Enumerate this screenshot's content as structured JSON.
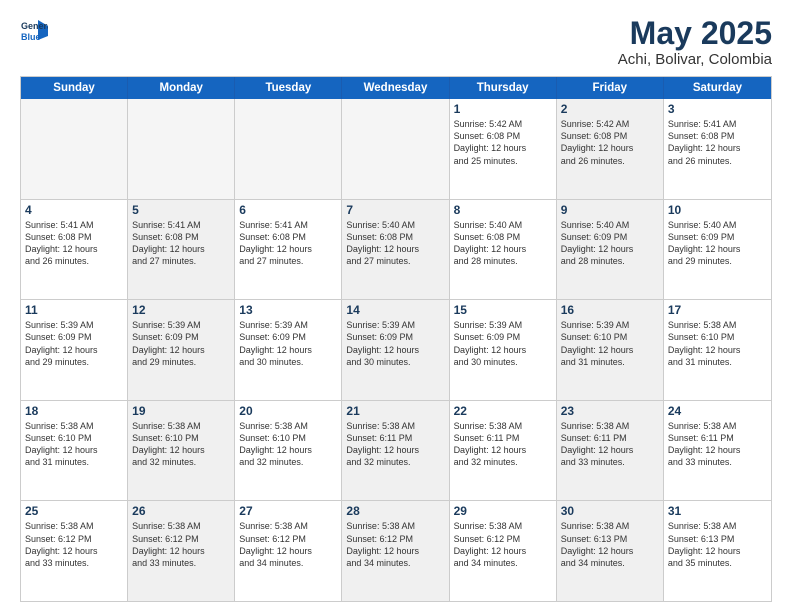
{
  "logo": {
    "line1": "General",
    "line2": "Blue"
  },
  "title": "May 2025",
  "subtitle": "Achi, Bolivar, Colombia",
  "header_days": [
    "Sunday",
    "Monday",
    "Tuesday",
    "Wednesday",
    "Thursday",
    "Friday",
    "Saturday"
  ],
  "weeks": [
    [
      {
        "day": "",
        "info": "",
        "shaded": true
      },
      {
        "day": "",
        "info": "",
        "shaded": true
      },
      {
        "day": "",
        "info": "",
        "shaded": true
      },
      {
        "day": "",
        "info": "",
        "shaded": true
      },
      {
        "day": "1",
        "info": "Sunrise: 5:42 AM\nSunset: 6:08 PM\nDaylight: 12 hours\nand 25 minutes.",
        "shaded": false
      },
      {
        "day": "2",
        "info": "Sunrise: 5:42 AM\nSunset: 6:08 PM\nDaylight: 12 hours\nand 26 minutes.",
        "shaded": true
      },
      {
        "day": "3",
        "info": "Sunrise: 5:41 AM\nSunset: 6:08 PM\nDaylight: 12 hours\nand 26 minutes.",
        "shaded": false
      }
    ],
    [
      {
        "day": "4",
        "info": "Sunrise: 5:41 AM\nSunset: 6:08 PM\nDaylight: 12 hours\nand 26 minutes.",
        "shaded": false
      },
      {
        "day": "5",
        "info": "Sunrise: 5:41 AM\nSunset: 6:08 PM\nDaylight: 12 hours\nand 27 minutes.",
        "shaded": true
      },
      {
        "day": "6",
        "info": "Sunrise: 5:41 AM\nSunset: 6:08 PM\nDaylight: 12 hours\nand 27 minutes.",
        "shaded": false
      },
      {
        "day": "7",
        "info": "Sunrise: 5:40 AM\nSunset: 6:08 PM\nDaylight: 12 hours\nand 27 minutes.",
        "shaded": true
      },
      {
        "day": "8",
        "info": "Sunrise: 5:40 AM\nSunset: 6:08 PM\nDaylight: 12 hours\nand 28 minutes.",
        "shaded": false
      },
      {
        "day": "9",
        "info": "Sunrise: 5:40 AM\nSunset: 6:09 PM\nDaylight: 12 hours\nand 28 minutes.",
        "shaded": true
      },
      {
        "day": "10",
        "info": "Sunrise: 5:40 AM\nSunset: 6:09 PM\nDaylight: 12 hours\nand 29 minutes.",
        "shaded": false
      }
    ],
    [
      {
        "day": "11",
        "info": "Sunrise: 5:39 AM\nSunset: 6:09 PM\nDaylight: 12 hours\nand 29 minutes.",
        "shaded": false
      },
      {
        "day": "12",
        "info": "Sunrise: 5:39 AM\nSunset: 6:09 PM\nDaylight: 12 hours\nand 29 minutes.",
        "shaded": true
      },
      {
        "day": "13",
        "info": "Sunrise: 5:39 AM\nSunset: 6:09 PM\nDaylight: 12 hours\nand 30 minutes.",
        "shaded": false
      },
      {
        "day": "14",
        "info": "Sunrise: 5:39 AM\nSunset: 6:09 PM\nDaylight: 12 hours\nand 30 minutes.",
        "shaded": true
      },
      {
        "day": "15",
        "info": "Sunrise: 5:39 AM\nSunset: 6:09 PM\nDaylight: 12 hours\nand 30 minutes.",
        "shaded": false
      },
      {
        "day": "16",
        "info": "Sunrise: 5:39 AM\nSunset: 6:10 PM\nDaylight: 12 hours\nand 31 minutes.",
        "shaded": true
      },
      {
        "day": "17",
        "info": "Sunrise: 5:38 AM\nSunset: 6:10 PM\nDaylight: 12 hours\nand 31 minutes.",
        "shaded": false
      }
    ],
    [
      {
        "day": "18",
        "info": "Sunrise: 5:38 AM\nSunset: 6:10 PM\nDaylight: 12 hours\nand 31 minutes.",
        "shaded": false
      },
      {
        "day": "19",
        "info": "Sunrise: 5:38 AM\nSunset: 6:10 PM\nDaylight: 12 hours\nand 32 minutes.",
        "shaded": true
      },
      {
        "day": "20",
        "info": "Sunrise: 5:38 AM\nSunset: 6:10 PM\nDaylight: 12 hours\nand 32 minutes.",
        "shaded": false
      },
      {
        "day": "21",
        "info": "Sunrise: 5:38 AM\nSunset: 6:11 PM\nDaylight: 12 hours\nand 32 minutes.",
        "shaded": true
      },
      {
        "day": "22",
        "info": "Sunrise: 5:38 AM\nSunset: 6:11 PM\nDaylight: 12 hours\nand 32 minutes.",
        "shaded": false
      },
      {
        "day": "23",
        "info": "Sunrise: 5:38 AM\nSunset: 6:11 PM\nDaylight: 12 hours\nand 33 minutes.",
        "shaded": true
      },
      {
        "day": "24",
        "info": "Sunrise: 5:38 AM\nSunset: 6:11 PM\nDaylight: 12 hours\nand 33 minutes.",
        "shaded": false
      }
    ],
    [
      {
        "day": "25",
        "info": "Sunrise: 5:38 AM\nSunset: 6:12 PM\nDaylight: 12 hours\nand 33 minutes.",
        "shaded": false
      },
      {
        "day": "26",
        "info": "Sunrise: 5:38 AM\nSunset: 6:12 PM\nDaylight: 12 hours\nand 33 minutes.",
        "shaded": true
      },
      {
        "day": "27",
        "info": "Sunrise: 5:38 AM\nSunset: 6:12 PM\nDaylight: 12 hours\nand 34 minutes.",
        "shaded": false
      },
      {
        "day": "28",
        "info": "Sunrise: 5:38 AM\nSunset: 6:12 PM\nDaylight: 12 hours\nand 34 minutes.",
        "shaded": true
      },
      {
        "day": "29",
        "info": "Sunrise: 5:38 AM\nSunset: 6:12 PM\nDaylight: 12 hours\nand 34 minutes.",
        "shaded": false
      },
      {
        "day": "30",
        "info": "Sunrise: 5:38 AM\nSunset: 6:13 PM\nDaylight: 12 hours\nand 34 minutes.",
        "shaded": true
      },
      {
        "day": "31",
        "info": "Sunrise: 5:38 AM\nSunset: 6:13 PM\nDaylight: 12 hours\nand 35 minutes.",
        "shaded": false
      }
    ]
  ]
}
